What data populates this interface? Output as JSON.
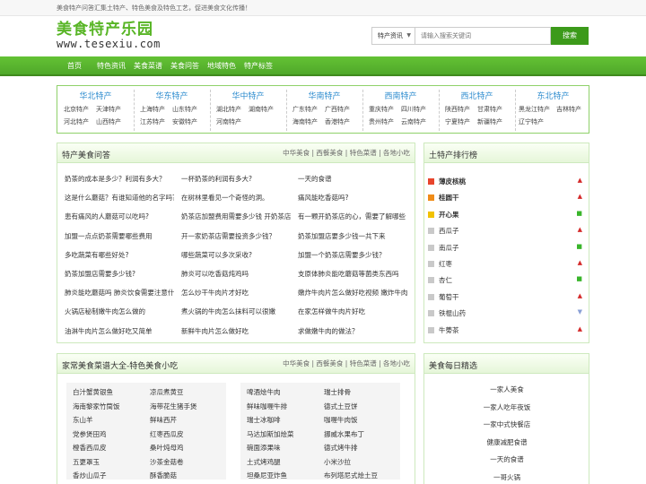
{
  "topbar": {
    "text": "美食特产问答汇集土特产、特色美食及特色工艺，促进美食文化传播！"
  },
  "logo": {
    "title": "美食特产乐园",
    "url": "www.tesexiu.com"
  },
  "search": {
    "select": "特产资讯",
    "placeholder": "请输入搜索关键词",
    "button": "搜索"
  },
  "nav": [
    "首页",
    "特色资讯",
    "美食菜谱",
    "美食问答",
    "地域特色",
    "特产标签"
  ],
  "regions": [
    {
      "title": "华北特产",
      "items": [
        "北京特产",
        "天津特产",
        "河北特产",
        "山西特产"
      ]
    },
    {
      "title": "华东特产",
      "items": [
        "上海特产",
        "山东特产",
        "江苏特产",
        "安徽特产"
      ]
    },
    {
      "title": "华中特产",
      "items": [
        "湖北特产",
        "湖南特产",
        "河南特产"
      ]
    },
    {
      "title": "华南特产",
      "items": [
        "广东特产",
        "广西特产",
        "海南特产",
        "香港特产"
      ]
    },
    {
      "title": "西南特产",
      "items": [
        "重庆特产",
        "四川特产",
        "贵州特产",
        "云南特产"
      ]
    },
    {
      "title": "西北特产",
      "items": [
        "陕西特产",
        "甘肃特产",
        "宁夏特产",
        "新疆特产"
      ]
    },
    {
      "title": "东北特产",
      "items": [
        "黑龙江特产",
        "吉林特产",
        "辽宁特产"
      ]
    }
  ],
  "qa": {
    "title": "特产美食问答",
    "links": "中华美食 | 西餐美食 | 特色菜谱 | 各地小吃",
    "items": [
      [
        "奶茶的成本是多少？利润有多大？",
        "一杯奶茶的利润有多大?",
        "一天的食谱"
      ],
      [
        "这是什么蘑菇？有谁知道他的名字吗？",
        "在树林里看见一个奇怪的洞。",
        "痛风能吃香菇吗?"
      ],
      [
        "患有痛风的人蘑菇可以吃吗?",
        "奶茶店加盟费用需要多少钱 开奶茶店",
        "有一颗开奶茶店的心，需要了解哪些"
      ],
      [
        "加盟一点点奶茶需要哪些费用",
        "开一家奶茶店需要投资多少钱？",
        "奶茶加盟店要多少钱一共下来"
      ],
      [
        "多吃蔬菜有哪些好处?",
        "哪些蔬菜可以多次采收?",
        "加盟一个奶茶店需要多少钱？"
      ],
      [
        "奶茶加盟店需要多少钱?",
        "肺炎可以吃香菇炖鸡吗",
        "支原体肺炎能吃蘑菇等菌类东西吗"
      ],
      [
        "肺炎能吃蘑菇吗 肺炎饮食需要注意什么",
        "怎么炒干牛肉片才好吃",
        "嫩炸牛肉片怎么做好吃视频 嫩炸牛肉"
      ],
      [
        "火锅店秘制嫩牛肉怎么做的",
        "煮火锅的牛肉怎么抹料可以很嫩",
        "在家怎样做牛肉片好吃"
      ],
      [
        "油淋牛肉片怎么做好吃又简单",
        "新鲜牛肉片怎么做好吃",
        "求做嫩牛肉的做法？"
      ]
    ]
  },
  "rank": {
    "title": "土特产排行榜",
    "items": [
      {
        "name": "薄皮核桃",
        "icon": "#e8452c",
        "trend": "▲",
        "trend_color": "#d42a2a",
        "bold": true
      },
      {
        "name": "桂圆干",
        "icon": "#f08c18",
        "trend": "▲",
        "trend_color": "#d42a2a",
        "bold": true
      },
      {
        "name": "开心果",
        "icon": "#f2c200",
        "trend": "■",
        "trend_color": "#39b52b",
        "bold": true
      },
      {
        "name": "西瓜子",
        "icon": "#c9c9c9",
        "trend": "▲",
        "trend_color": "#d42a2a",
        "bold": false
      },
      {
        "name": "南瓜子",
        "icon": "#c9c9c9",
        "trend": "■",
        "trend_color": "#39b52b",
        "bold": false
      },
      {
        "name": "红枣",
        "icon": "#c9c9c9",
        "trend": "▲",
        "trend_color": "#d42a2a",
        "bold": false
      },
      {
        "name": "杏仁",
        "icon": "#c9c9c9",
        "trend": "■",
        "trend_color": "#39b52b",
        "bold": false
      },
      {
        "name": "葡萄干",
        "icon": "#c9c9c9",
        "trend": "▲",
        "trend_color": "#d42a2a",
        "bold": false
      },
      {
        "name": "铁棍山药",
        "icon": "#c9c9c9",
        "trend": "▼",
        "trend_color": "#8aa0d6",
        "bold": false
      },
      {
        "name": "牛蒡茶",
        "icon": "#c9c9c9",
        "trend": "▲",
        "trend_color": "#d42a2a",
        "bold": false
      }
    ]
  },
  "recipes": {
    "title": "家常美食菜谱大全-特色美食小吃",
    "links": "中华美食 | 西餐美食 | 特色菜谱 | 各地小吃",
    "box1": [
      [
        "白汁蟹黄银鱼",
        "凉瓜煮黄豆"
      ],
      [
        "海南黎家竹筒饭",
        "海带花生猪手煲"
      ],
      [
        "东山羊",
        "鲜味西芹"
      ],
      [
        "党参煲田鸡",
        "红枣西瓜皮"
      ],
      [
        "橙香西瓜皮",
        "桑叶炖母鸡"
      ],
      [
        "五更罩玉",
        "沙茶金菇卷"
      ],
      [
        "香炒山瓜子",
        "酥香脆菇"
      ]
    ],
    "box2": [
      [
        "啤酒烩牛肉",
        "瑞士排骨"
      ],
      [
        "鲜味咖喱牛排",
        "德式土豆饼"
      ],
      [
        "瑞士冰咖啡",
        "咖喱牛肉饭"
      ],
      [
        "马达加斯加烩菜",
        "挪威水果布丁"
      ],
      [
        "碗面添果味",
        "德式烤牛排"
      ],
      [
        "土式烤鸡腿",
        "小米沙拉"
      ],
      [
        "坦桑尼亚炸鱼",
        "布列塔尼式烩土豆"
      ]
    ]
  },
  "daily": {
    "title": "美食每日精选",
    "items": [
      "一家人美食",
      "一家人吃年夜饭",
      "一家中式快餐店",
      "健康减肥食谱",
      "一天的食谱",
      "一哥火锅"
    ]
  }
}
